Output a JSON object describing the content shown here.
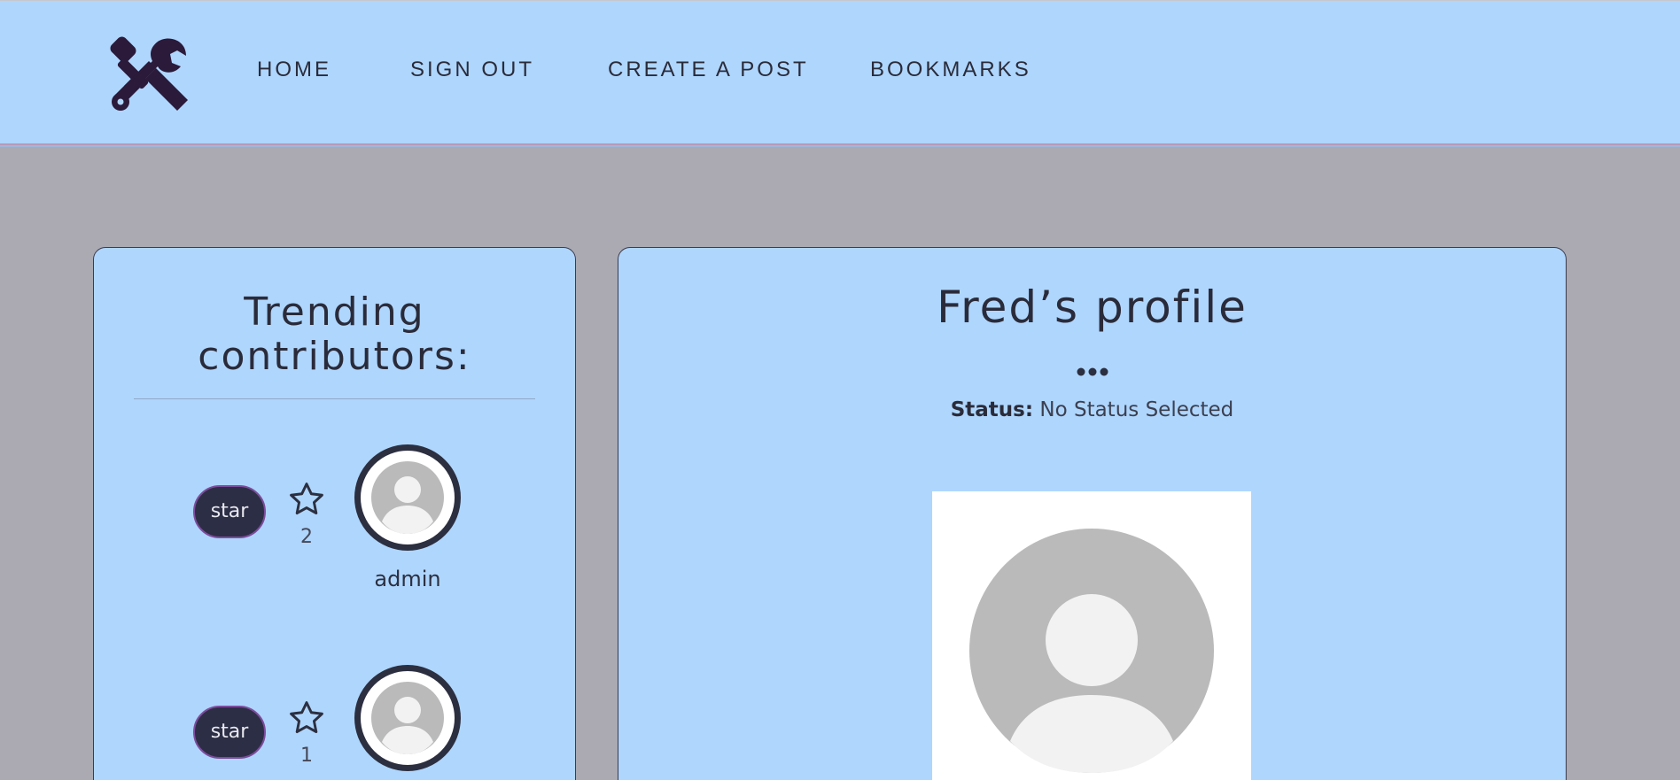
{
  "nav": {
    "logo": "tools-icon",
    "links": [
      "HOME",
      "SIGN OUT",
      "CREATE A POST",
      "BOOKMARKS"
    ]
  },
  "trending": {
    "title_line1": "Trending",
    "title_line2": "contributors:",
    "contributors": [
      {
        "star_label": "star",
        "star_count": "2",
        "name": "admin"
      },
      {
        "star_label": "star",
        "star_count": "1",
        "name": ""
      }
    ]
  },
  "profile": {
    "title": "Fred’s profile",
    "status_label": "Status:",
    "status_value": "No Status Selected"
  },
  "colors": {
    "header_bg": "#afd6fd",
    "page_bg": "#abaab3",
    "button_bg": "#2c2e45",
    "text_dark": "#2a2b3a"
  }
}
